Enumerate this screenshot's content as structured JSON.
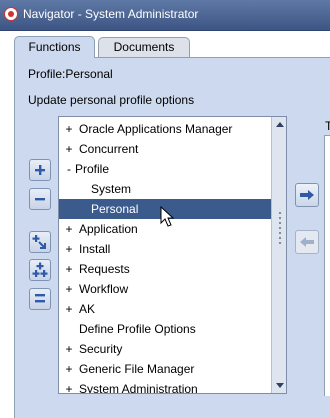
{
  "window": {
    "title": "Navigator - System Administrator"
  },
  "tabs": [
    {
      "label": "Functions",
      "active": true
    },
    {
      "label": "Documents",
      "active": false
    }
  ],
  "profile_label": "Profile:Personal",
  "instruction": "Update personal profile options",
  "right_heading_fragment": "T",
  "tree": {
    "items": [
      {
        "marker": "+",
        "label": "Oracle Applications Manager",
        "indent": 0,
        "selected": false
      },
      {
        "marker": "+",
        "label": "Concurrent",
        "indent": 0,
        "selected": false
      },
      {
        "marker": "-",
        "label": "Profile",
        "indent": 0,
        "selected": false
      },
      {
        "marker": "",
        "label": "System",
        "indent": 1,
        "selected": false
      },
      {
        "marker": "",
        "label": "Personal",
        "indent": 1,
        "selected": true
      },
      {
        "marker": "+",
        "label": "Application",
        "indent": 0,
        "selected": false
      },
      {
        "marker": "+",
        "label": "Install",
        "indent": 0,
        "selected": false
      },
      {
        "marker": "+",
        "label": "Requests",
        "indent": 0,
        "selected": false
      },
      {
        "marker": "+",
        "label": "Workflow",
        "indent": 0,
        "selected": false
      },
      {
        "marker": "+",
        "label": "AK",
        "indent": 0,
        "selected": false
      },
      {
        "marker": "",
        "label": "Define Profile Options",
        "indent": 0,
        "selected": false
      },
      {
        "marker": "+",
        "label": "Security",
        "indent": 0,
        "selected": false
      },
      {
        "marker": "+",
        "label": "Generic File Manager",
        "indent": 0,
        "selected": false
      },
      {
        "marker": "+",
        "label": "System Administration",
        "indent": 0,
        "selected": false
      }
    ]
  },
  "colors": {
    "titlebar": "#4b6593",
    "panel": "#cdd9ee",
    "selection": "#3b5b8c",
    "button_icon": "#2f5aa8"
  },
  "icons": {
    "expand": "plus-icon",
    "collapse": "minus-icon",
    "expand_branch": "expand-branch-icon",
    "expand_all": "expand-all-icon",
    "collapse_all": "collapse-all-icon",
    "add_to_top_ten": "right-arrow-icon",
    "remove_from_top_ten": "left-arrow-icon"
  }
}
